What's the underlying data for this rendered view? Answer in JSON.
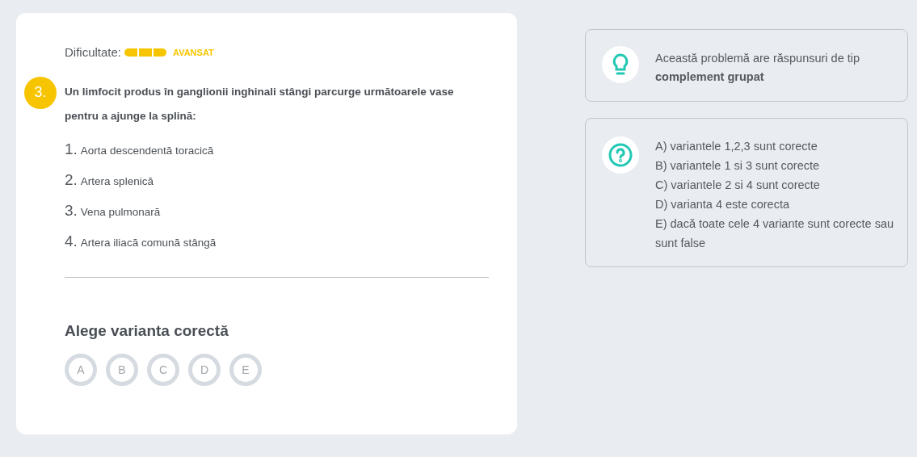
{
  "question": {
    "difficulty_label": "Dificultate:",
    "difficulty": {
      "stars": 3,
      "label": "AVANSAT"
    },
    "number": "3.",
    "text": "Un limfocit produs în ganglionii inghinali stângi parcurge următoarele vase pentru a ajunge la splină:",
    "items": [
      {
        "number": "1.",
        "text": "Aorta descendentă toracică"
      },
      {
        "number": "2.",
        "text": "Artera splenică"
      },
      {
        "number": "3.",
        "text": "Vena pulmonară"
      },
      {
        "number": "4.",
        "text": "Artera iliacă comună stângă"
      }
    ],
    "answer_heading": "Alege varianta corectă",
    "choices": [
      {
        "label": "A",
        "selected": false
      },
      {
        "label": "B",
        "selected": false
      },
      {
        "label": "C",
        "selected": false
      },
      {
        "label": "D",
        "selected": false
      },
      {
        "label": "E",
        "selected": false
      }
    ]
  },
  "hint": {
    "text": "Această problemă are răspunsuri de tip **complement grupat**"
  },
  "legend": {
    "lines": [
      "A) variantele 1,2,3 sunt corecte",
      "B) variantele 1 si 3 sunt corecte",
      "C) variantele 2 si 4 sunt corecte",
      "D) varianta 4 este corecta",
      "E) dacă toate cele 4 variante sunt corecte sau sunt false"
    ]
  }
}
